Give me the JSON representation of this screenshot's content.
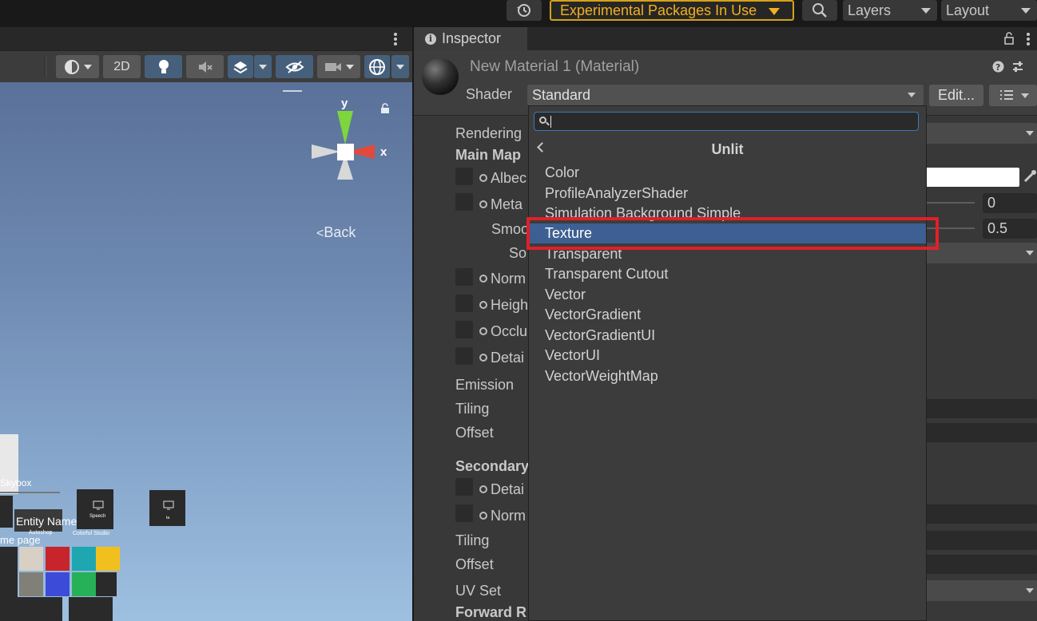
{
  "topbar": {
    "experimental_label": "Experimental Packages In Use",
    "layers_label": "Layers",
    "layout_label": "Layout"
  },
  "scene": {
    "mode_2d_label": "2D",
    "back_label": "Back",
    "gizmo_y": "y",
    "gizmo_x": "x",
    "skybox_label": "Skybox",
    "entity_label": "Entity Name",
    "autoshop_label": "Autoshop",
    "colorful_label": "Colorful Studio",
    "homepage_label": "me page",
    "speech_label": "Speech",
    "tile_label": "ta",
    "swatch_colors": [
      "#d8d0c4",
      "#c8242c",
      "#1ea7b0",
      "#f2c01e",
      "#808078",
      "#3c4cd8",
      "#26b058"
    ]
  },
  "inspector": {
    "tab_label": "Inspector",
    "material_title": "New Material 1 (Material)",
    "shader_label": "Shader",
    "shader_value": "Standard",
    "edit_label": "Edit...",
    "props": {
      "rendering": "Rendering",
      "main_maps": "Main Map",
      "albedo": "Albec",
      "metallic": "Meta",
      "smoothness": "Smoo",
      "source": "So",
      "normal": "Norm",
      "height": "Heigh",
      "occlusion": "Occlu",
      "detail": "Detai",
      "emission": "Emission",
      "tiling": "Tiling",
      "offset": "Offset",
      "secondary": "Secondary",
      "detail2": "Detai",
      "normal2": "Norm",
      "tiling2": "Tiling",
      "offset2": "Offset",
      "uv_set": "UV Set",
      "forward": "Forward R"
    },
    "metallic_value": "0",
    "smoothness_value": "0.5"
  },
  "shader_popup": {
    "search_value": "",
    "category_title": "Unlit",
    "items": [
      "Color",
      "ProfileAnalyzerShader",
      "Simulation Background Simple",
      "Texture",
      "Transparent",
      "Transparent Cutout",
      "Vector",
      "VectorGradient",
      "VectorGradientUI",
      "VectorUI",
      "VectorWeightMap"
    ],
    "selected_index": 3
  },
  "colors": {
    "accent_selection": "#3d5f91",
    "warning_border": "#d6a21a",
    "annotation_red": "#e0202a"
  }
}
